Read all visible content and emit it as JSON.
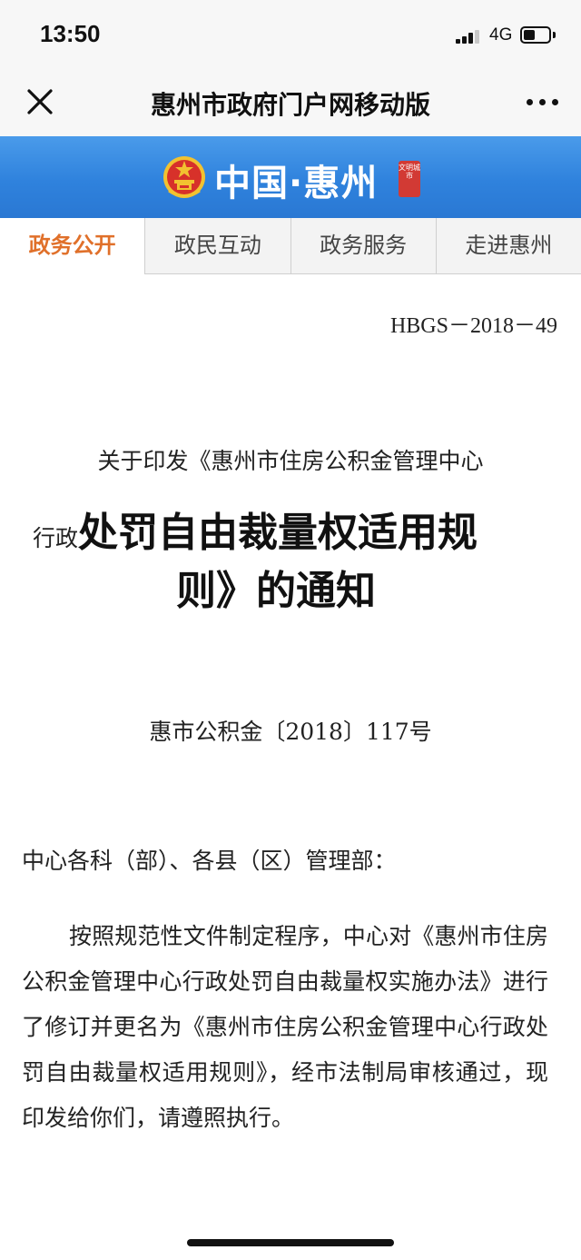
{
  "status_bar": {
    "time": "13:50",
    "network": "4G",
    "signal_bars_active": 3,
    "signal_bars_total": 4,
    "battery_level": 0.45,
    "icons": [
      "signal-icon",
      "battery-icon"
    ]
  },
  "nav": {
    "title": "惠州市政府门户网移动版",
    "close_icon": "close-icon",
    "more_icon": "more-icon"
  },
  "banner": {
    "brand": "中国·惠州",
    "seal_text": "文明城市",
    "colors": {
      "background": "#2f82dd",
      "seal": "#d23a34"
    }
  },
  "tabs": [
    {
      "label": "政务公开",
      "active": true
    },
    {
      "label": "政民互动",
      "active": false
    },
    {
      "label": "政务服务",
      "active": false
    },
    {
      "label": "走进惠州",
      "active": false
    }
  ],
  "accent_color": "#e0702a",
  "document": {
    "code": "HBGS－2018－49",
    "title_line1": "关于印发《惠州市住房公积金管理中心",
    "title_prefix": "行政",
    "title_main_line1": "处罚自由裁量权适用规",
    "title_main_line2": "则》的通知",
    "number": "惠市公积金〔2018〕117号",
    "salutation": "中心各科（部）、各县（区）管理部：",
    "body": "按照规范性文件制定程序，中心对《惠州市住房公积金管理中心行政处罚自由裁量权实施办法》进行了修订并更名为《惠州市住房公积金管理中心行政处罚自由裁量权适用规则》，经市法制局审核通过，现印发给你们，请遵照执行。"
  }
}
